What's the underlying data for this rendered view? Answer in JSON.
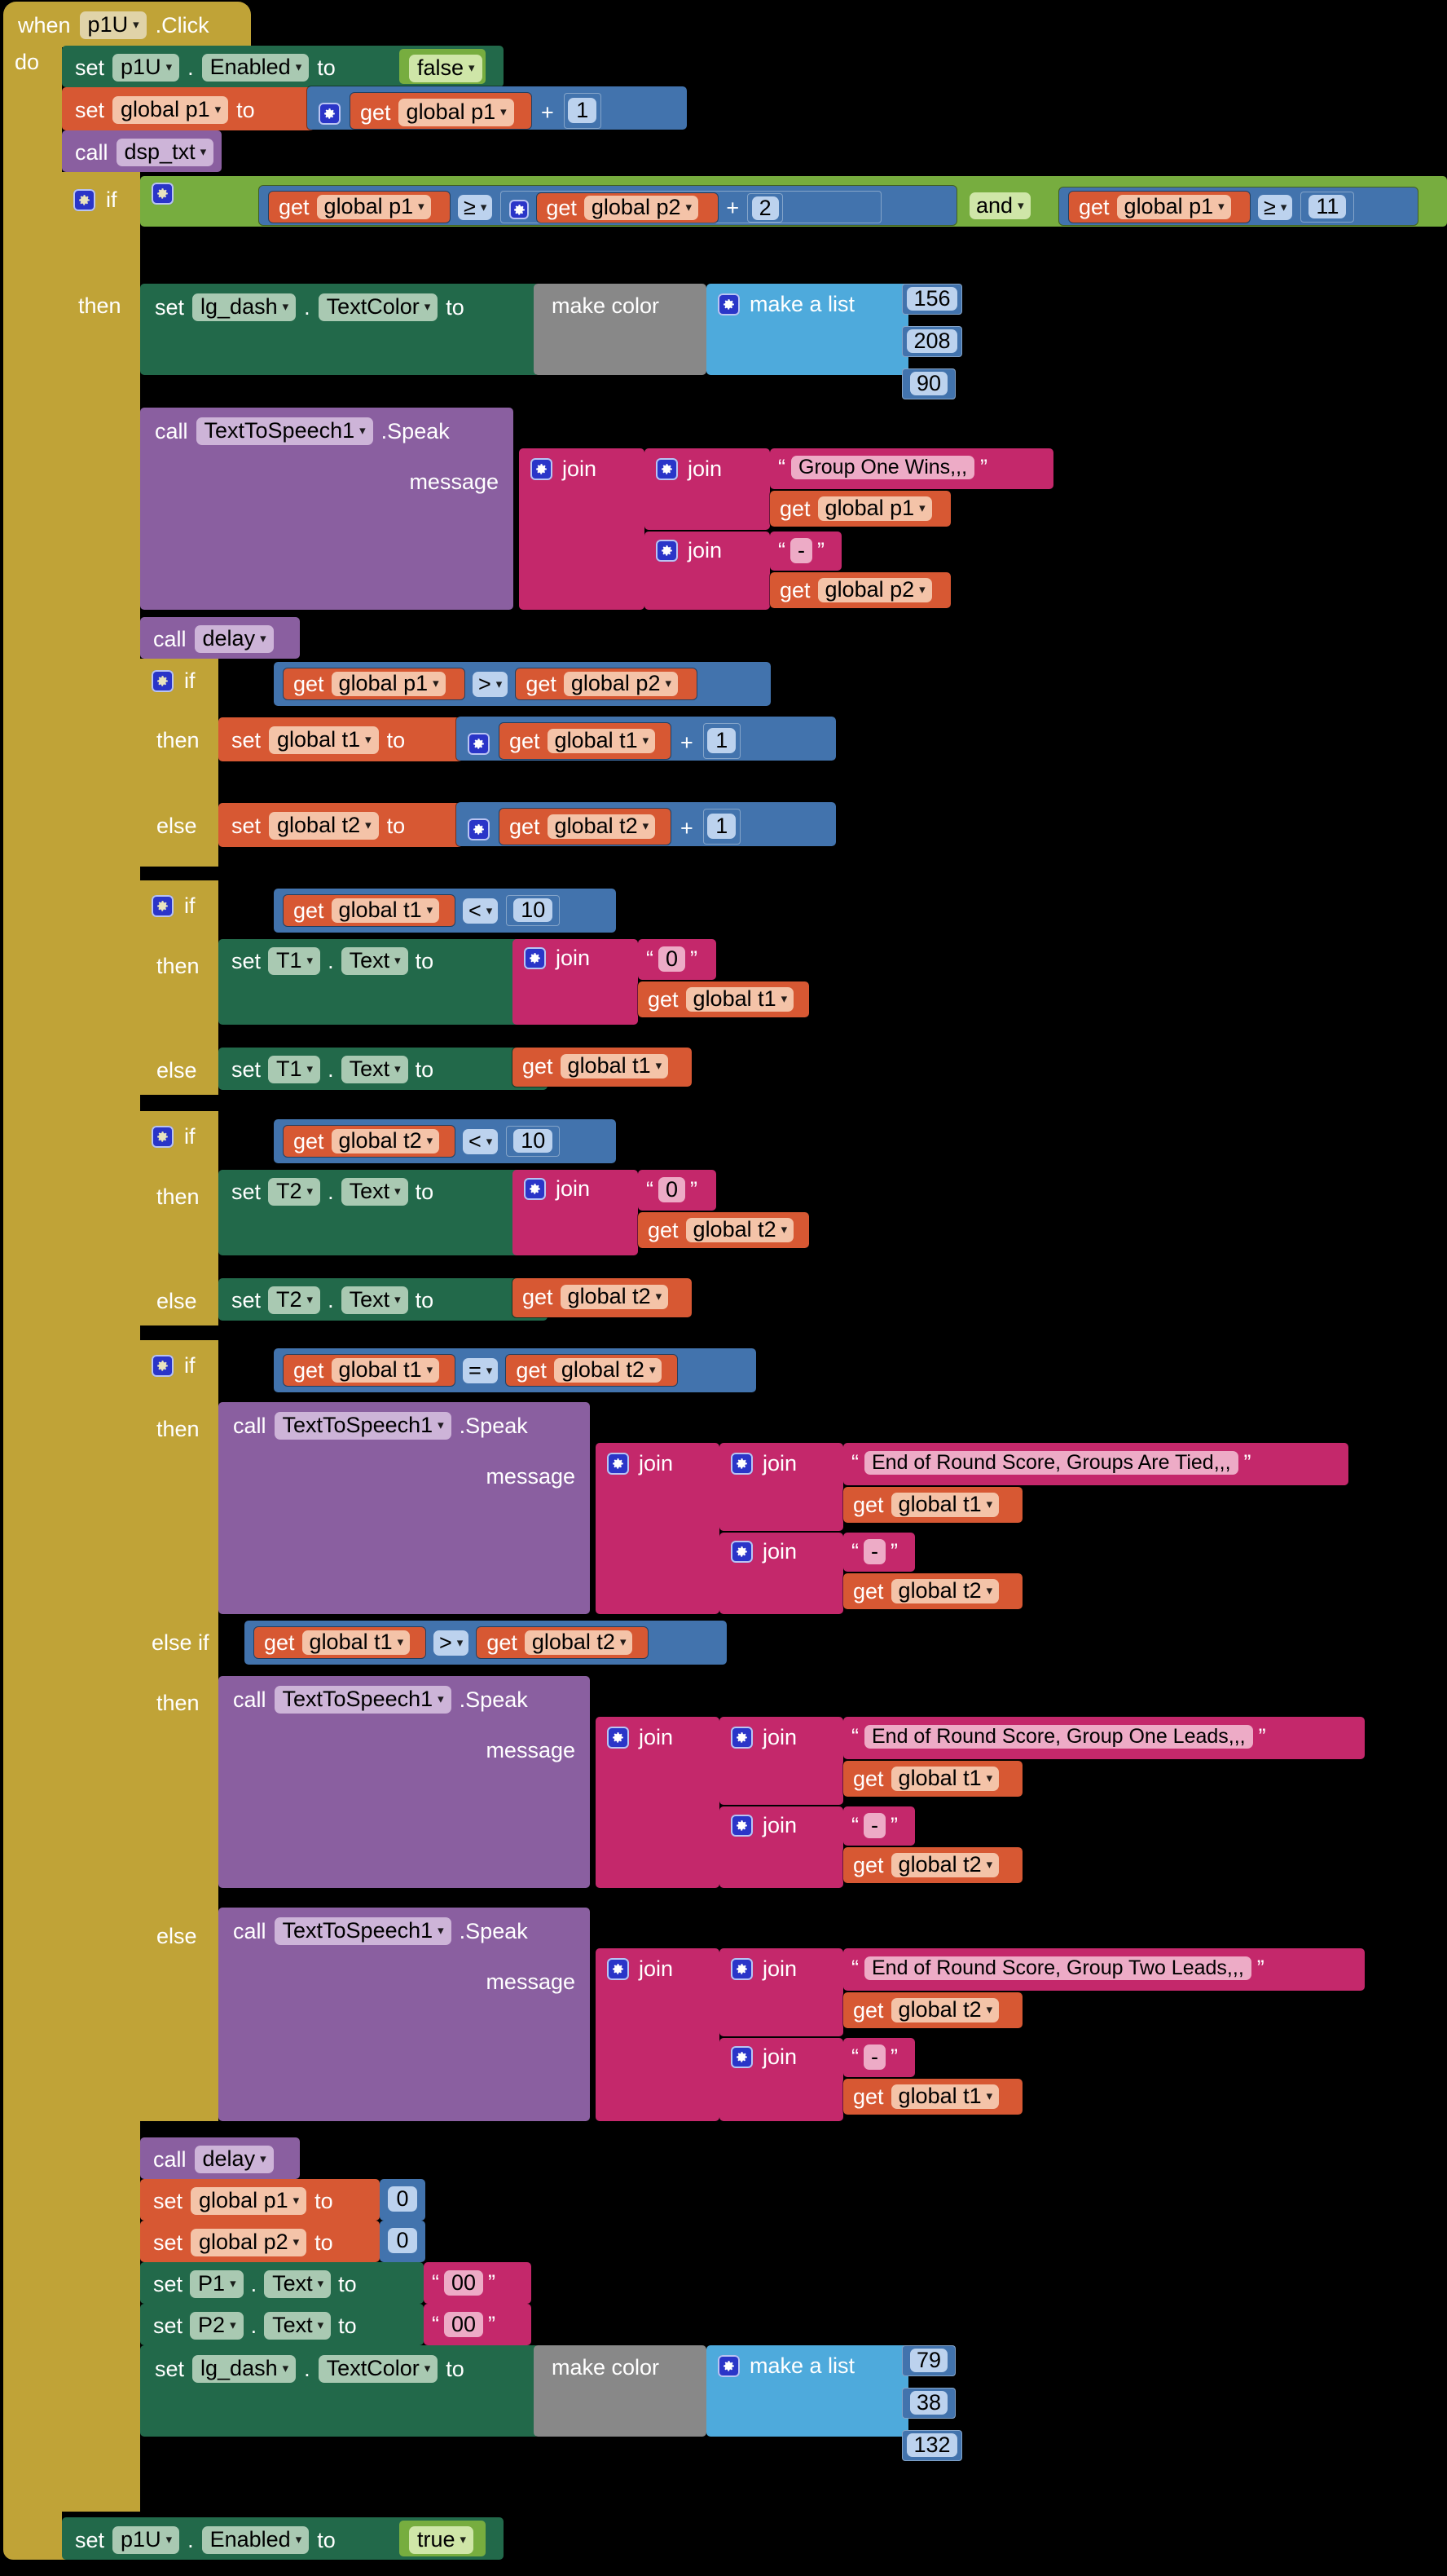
{
  "app": "MIT App Inventor Blocks Editor",
  "screen_bg": "#000000",
  "palette": {
    "event": "#c0a337",
    "setter": "#22694a",
    "variable": "#d75833",
    "procedure": "#8a5fa0",
    "control": "#c0a337",
    "logic": "#77ad3f",
    "math": "#4273ad",
    "text": "#c4286b",
    "list": "#4eaadc",
    "color": "#888888"
  },
  "labels": {
    "when": "when",
    "do": "do",
    "set": "set",
    "get": "get",
    "to": "to",
    "call": "call",
    "if": "if",
    "then": "then",
    "else": "else",
    "else_if": "else if",
    "join": "join",
    "message": "message",
    "make_color": "make color",
    "make_a_list": "make a list",
    "dot": ".",
    "plus": "+",
    "quote_open": "“",
    "quote_close": "”"
  },
  "event": {
    "component": "p1U",
    "method": ".Click"
  },
  "statements": {
    "set_p1u_enabled_false": {
      "component": "p1U",
      "property": "Enabled",
      "value": "false"
    },
    "set_global_p1_increment": {
      "variable": "global p1",
      "operand": "global p1",
      "operator": "+",
      "addend": "1"
    },
    "call_dsp_txt": {
      "procedure": "dsp_txt"
    },
    "main_if": {
      "left_cond": {
        "a": "global p1",
        "op": "≥",
        "b_left": "global p2",
        "b_op": "+",
        "b_right": "2"
      },
      "connector": "and",
      "right_cond": {
        "a": "global p1",
        "op": "≥",
        "b": "11"
      }
    },
    "set_lg_dash_win_color": {
      "component": "lg_dash",
      "property": "TextColor",
      "rgb": [
        "156",
        "208",
        "90"
      ]
    },
    "speak_group_one_wins": {
      "component": "TextToSpeech1",
      "method": ".Speak",
      "text": "Group One Wins,,,",
      "var_a": "global p1",
      "separator": "-",
      "var_b": "global p2"
    },
    "call_delay_1": {
      "procedure": "delay"
    },
    "if_p1_gt_p2": {
      "cond": {
        "a": "global p1",
        "op": ">",
        "b": "global p2"
      },
      "then": {
        "variable": "global t1",
        "operand": "global t1",
        "op": "+",
        "addend": "1"
      },
      "else": {
        "variable": "global t2",
        "operand": "global t2",
        "op": "+",
        "addend": "1"
      }
    },
    "if_t1_lt_10": {
      "cond": {
        "a": "global t1",
        "op": "<",
        "b": "10"
      },
      "then": {
        "component": "T1",
        "property": "Text",
        "pad": "0",
        "variable": "global t1"
      },
      "else": {
        "component": "T1",
        "property": "Text",
        "variable": "global t1"
      }
    },
    "if_t2_lt_10": {
      "cond": {
        "a": "global t2",
        "op": "<",
        "b": "10"
      },
      "then": {
        "component": "T2",
        "property": "Text",
        "pad": "0",
        "variable": "global t2"
      },
      "else": {
        "component": "T2",
        "property": "Text",
        "variable": "global t2"
      }
    },
    "score_if": {
      "if_cond": {
        "a": "global t1",
        "op": "=",
        "b": "global t2"
      },
      "if_speak": {
        "component": "TextToSpeech1",
        "method": ".Speak",
        "text": "End of Round Score, Groups Are Tied,,,",
        "var_a": "global t1",
        "separator": "-",
        "var_b": "global t2"
      },
      "elseif_cond": {
        "a": "global t1",
        "op": ">",
        "b": "global t2"
      },
      "elseif_speak": {
        "component": "TextToSpeech1",
        "method": ".Speak",
        "text": "End of Round Score, Group One Leads,,,",
        "var_a": "global t1",
        "separator": "-",
        "var_b": "global t2"
      },
      "else_speak": {
        "component": "TextToSpeech1",
        "method": ".Speak",
        "text": "End of Round Score, Group Two Leads,,,",
        "var_a": "global t2",
        "separator": "-",
        "var_b": "global t1"
      }
    },
    "call_delay_2": {
      "procedure": "delay"
    },
    "reset_global_p1": {
      "variable": "global p1",
      "value": "0"
    },
    "reset_global_p2": {
      "variable": "global p2",
      "value": "0"
    },
    "reset_P1_text": {
      "component": "P1",
      "property": "Text",
      "value": "00"
    },
    "reset_P2_text": {
      "component": "P2",
      "property": "Text",
      "value": "00"
    },
    "set_lg_dash_reset_color": {
      "component": "lg_dash",
      "property": "TextColor",
      "rgb": [
        "79",
        "38",
        "132"
      ]
    },
    "set_p1u_enabled_true": {
      "component": "p1U",
      "property": "Enabled",
      "value": "true"
    }
  }
}
